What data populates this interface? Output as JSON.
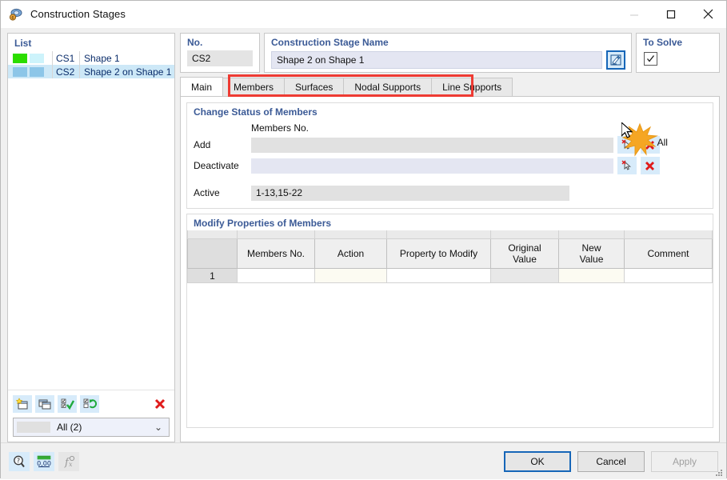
{
  "window": {
    "title": "Construction Stages",
    "icon": "construction-stages-icon",
    "minimize": "—",
    "maximize": "□",
    "close": "✕"
  },
  "list_panel": {
    "caption": "List",
    "columns": [
      "colors",
      "no",
      "name"
    ],
    "rows": [
      {
        "no": "CS1",
        "name": "Shape 1",
        "color1": "#2bdd00",
        "color2": "#cdf3fb",
        "selected": false
      },
      {
        "no": "CS2",
        "name": "Shape 2 on Shape 1",
        "color1": "#8dc6e8",
        "color2": "#8dc6e8",
        "selected": true
      }
    ],
    "toolbar": [
      {
        "name": "new-stage-button",
        "label": "New"
      },
      {
        "name": "copy-stage-button",
        "label": "Copy"
      },
      {
        "name": "select-all-button",
        "label": "Select All"
      },
      {
        "name": "invert-selection-button",
        "label": "Invert Selection"
      },
      {
        "name": "delete-stage-button",
        "label": "Delete"
      }
    ],
    "filter_combo": {
      "value": "All (2)",
      "arrow": "⌄"
    }
  },
  "no_box": {
    "caption": "No.",
    "value": "CS2"
  },
  "name_box": {
    "caption": "Construction Stage Name",
    "value": "Shape 2 on Shape 1",
    "edit_button": "edit-name-button"
  },
  "solve_box": {
    "caption": "To Solve",
    "checked": true,
    "check_glyph": "✓"
  },
  "tabs": {
    "items": [
      {
        "label": "Main",
        "active": true
      },
      {
        "label": "Members",
        "active": false
      },
      {
        "label": "Surfaces",
        "active": false
      },
      {
        "label": "Nodal Supports",
        "active": false
      },
      {
        "label": "Line Supports",
        "active": false
      }
    ],
    "highlight_color": "#ee3b33"
  },
  "change_status": {
    "title": "Change Status of Members",
    "sub_header": "Members No.",
    "rows": [
      {
        "label": "Add",
        "value": "",
        "style": "grey"
      },
      {
        "label": "Deactivate",
        "value": "",
        "style": "lav"
      }
    ],
    "active_label": "Active",
    "active_value": "1-13,15-22",
    "all_label": "All",
    "pick_button": "pick-members-button",
    "clear_button": "clear-members-button"
  },
  "modify_table": {
    "title": "Modify Properties of Members",
    "columns": [
      "",
      "Members No.",
      "Action",
      "Property to Modify",
      "Original\nValue",
      "New\nValue",
      "Comment"
    ],
    "column_labels": {
      "index": "",
      "members_no": "Members No.",
      "action": "Action",
      "property": "Property to Modify",
      "original_1": "Original",
      "original_2": "Value",
      "new_1": "New",
      "new_2": "Value",
      "comment": "Comment"
    },
    "rows": [
      {
        "index": "1",
        "members_no": "",
        "action": "",
        "property": "",
        "original_value": "",
        "new_value": "",
        "comment": ""
      }
    ]
  },
  "footer": {
    "icons": [
      {
        "name": "help-button",
        "label": "Help"
      },
      {
        "name": "decimal-places-button",
        "label": "0,00"
      },
      {
        "name": "formula-button",
        "label": "fx",
        "disabled": true
      }
    ],
    "ok": "OK",
    "cancel": "Cancel",
    "apply": "Apply"
  },
  "colors": {
    "accent_blue": "#1666b8",
    "caption_blue": "#3b5a96",
    "highlight_red": "#ee3b33",
    "selection": "#cde8f7",
    "star_orange": "#f5a623"
  }
}
